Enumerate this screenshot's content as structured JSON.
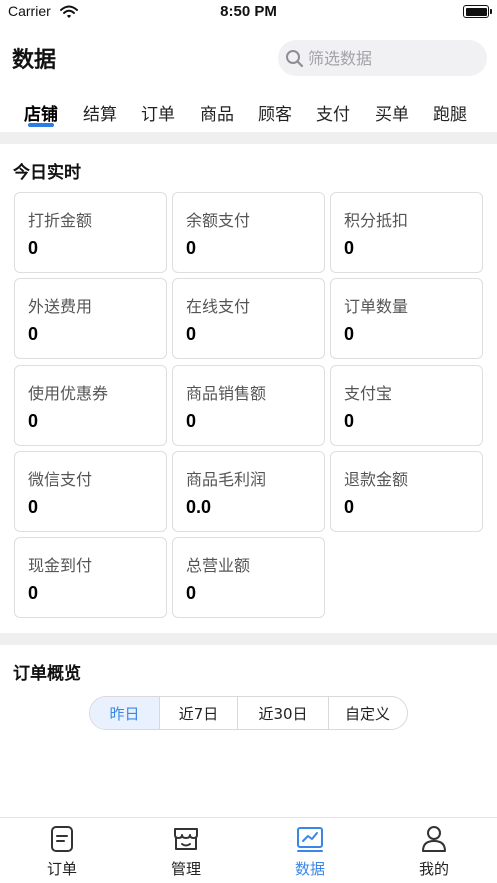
{
  "status_bar": {
    "carrier": "Carrier",
    "time": "8:50 PM"
  },
  "header": {
    "title": "数据",
    "search_placeholder": "筛选数据"
  },
  "tabs": [
    {
      "label": "店铺",
      "active": true
    },
    {
      "label": "结算",
      "active": false
    },
    {
      "label": "订单",
      "active": false
    },
    {
      "label": "商品",
      "active": false
    },
    {
      "label": "顾客",
      "active": false
    },
    {
      "label": "支付",
      "active": false
    },
    {
      "label": "买单",
      "active": false
    },
    {
      "label": "跑腿",
      "active": false
    }
  ],
  "today": {
    "title": "今日实时",
    "stats": [
      {
        "label": "打折金额",
        "value": "0"
      },
      {
        "label": "余额支付",
        "value": "0"
      },
      {
        "label": "积分抵扣",
        "value": "0"
      },
      {
        "label": "外送费用",
        "value": "0"
      },
      {
        "label": "在线支付",
        "value": "0"
      },
      {
        "label": "订单数量",
        "value": "0"
      },
      {
        "label": "使用优惠券",
        "value": "0"
      },
      {
        "label": "商品销售额",
        "value": "0"
      },
      {
        "label": "支付宝",
        "value": "0"
      },
      {
        "label": "微信支付",
        "value": "0"
      },
      {
        "label": "商品毛利润",
        "value": "0.0"
      },
      {
        "label": "退款金额",
        "value": "0"
      },
      {
        "label": "现金到付",
        "value": "0"
      },
      {
        "label": "总营业额",
        "value": "0"
      }
    ]
  },
  "overview": {
    "title": "订单概览",
    "ranges": [
      {
        "label": "昨日",
        "active": true
      },
      {
        "label": "近7日",
        "active": false
      },
      {
        "label": "近30日",
        "active": false
      },
      {
        "label": "自定义",
        "active": false
      }
    ]
  },
  "tabbar": [
    {
      "label": "订单",
      "icon": "document-icon",
      "active": false
    },
    {
      "label": "管理",
      "icon": "store-icon",
      "active": false
    },
    {
      "label": "数据",
      "icon": "chart-icon",
      "active": true
    },
    {
      "label": "我的",
      "icon": "user-icon",
      "active": false
    }
  ],
  "colors": {
    "accent": "#3a87e8",
    "tab_underline": "#2d7be5",
    "divider": "#efefef"
  }
}
